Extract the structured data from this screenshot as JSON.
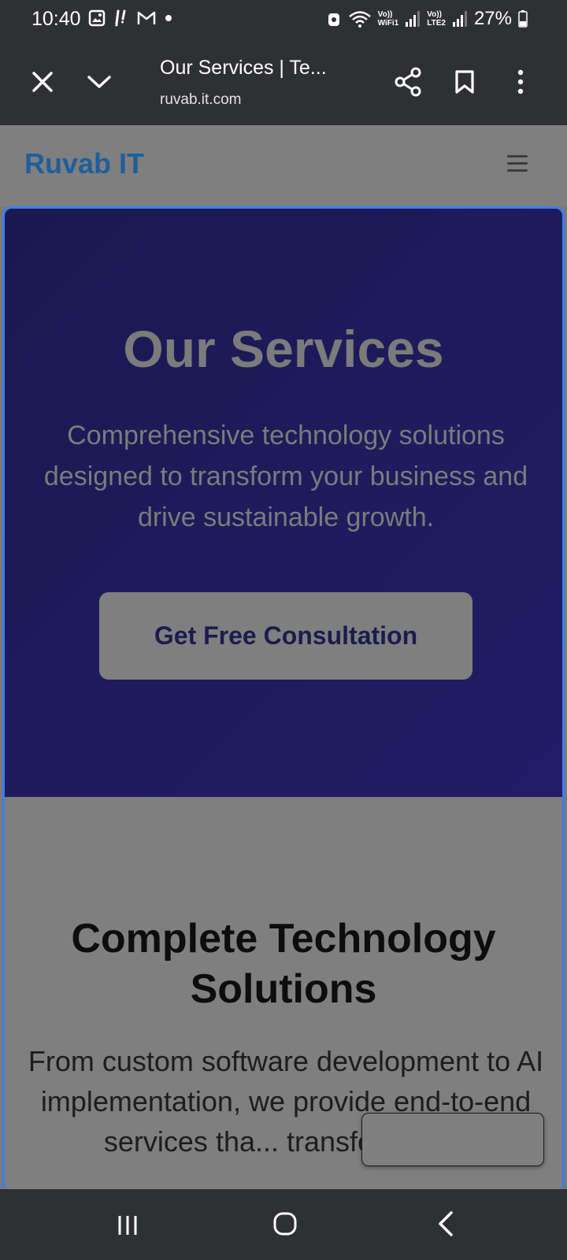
{
  "status_bar": {
    "time": "10:40",
    "network_labels": {
      "wifi_top": "Vo))",
      "wifi_bottom": "WiFi1",
      "lte_top": "Vo))",
      "lte_bottom": "LTE2"
    },
    "battery": "27%"
  },
  "browser": {
    "tab_title": "Our Services | Te...",
    "url": "ruvab.it.com"
  },
  "site": {
    "brand": "Ruvab IT"
  },
  "hero": {
    "title": "Our Services",
    "subtitle": "Comprehensive technology solutions designed to transform your business and drive sustainable growth.",
    "cta_label": "Get Free Consultation"
  },
  "section": {
    "title": "Complete Technology Solutions",
    "description": "From custom software development to AI implementation, we provide end-to-end services tha... transformation"
  },
  "colors": {
    "accent_border": "#3d7cf0",
    "brand": "#1f5e9c",
    "hero_bg": "#1e1c5e",
    "chrome_bg": "#2f3034"
  },
  "icons": [
    "gallery-icon",
    "notification-icon",
    "gmail-icon",
    "dot-icon",
    "alarm-icon",
    "wifi-icon",
    "signal-icon",
    "battery-icon",
    "close-icon",
    "chevron-down-icon",
    "share-icon",
    "bookmark-icon",
    "more-vert-icon",
    "hamburger-icon",
    "recents-icon",
    "home-icon",
    "back-icon"
  ]
}
